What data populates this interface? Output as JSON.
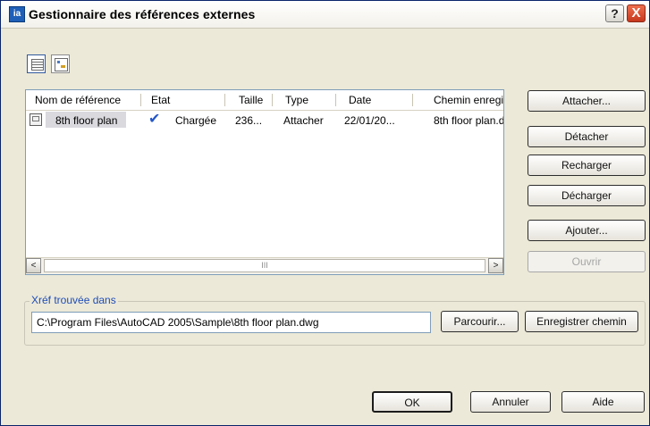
{
  "window": {
    "title": "Gestionnaire des références externes",
    "help_glyph": "?",
    "close_glyph": "X",
    "app_icon_glyph": "ia"
  },
  "toolbar": {
    "list_view_icon": "list-view-icon",
    "tree_view_icon": "tree-view-icon"
  },
  "table": {
    "columns": [
      "Nom de référence",
      "Etat",
      "Taille",
      "Type",
      "Date",
      "Chemin enregi"
    ],
    "rows": [
      {
        "name": "8th floor plan",
        "status_check": "✔",
        "status": "Chargée",
        "size": "236...",
        "type": "Attacher",
        "date": "22/01/20...",
        "path": "8th floor plan.d"
      }
    ]
  },
  "scrollbar": {
    "left_arrow": "<",
    "right_arrow": ">",
    "thumb_grip": "III"
  },
  "buttons": {
    "attach": "Attacher...",
    "detach": "Détacher",
    "reload": "Recharger",
    "unload": "Décharger",
    "add": "Ajouter...",
    "open": "Ouvrir"
  },
  "found_in": {
    "label": "Xréf trouvée dans",
    "path": "C:\\Program Files\\AutoCAD 2005\\Sample\\8th floor plan.dwg",
    "browse": "Parcourir...",
    "save_path": "Enregistrer chemin"
  },
  "footer": {
    "ok": "OK",
    "cancel": "Annuler",
    "help": "Aide"
  }
}
